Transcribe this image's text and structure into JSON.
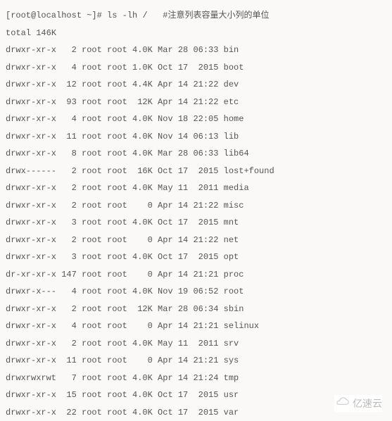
{
  "prompt": "[root@localhost ~]# ",
  "command": "ls -lh /",
  "spacer": "   ",
  "comment": "#注意列表容量大小列的单位",
  "total_label": "total ",
  "total_value": "146K",
  "rows": [
    {
      "perm": "drwxr-xr-x",
      "links": "2",
      "owner": "root",
      "group": "root",
      "size": "4.0K",
      "date": "Mar 28 06:33",
      "name": "bin"
    },
    {
      "perm": "drwxr-xr-x",
      "links": "4",
      "owner": "root",
      "group": "root",
      "size": "1.0K",
      "date": "Oct 17  2015",
      "name": "boot"
    },
    {
      "perm": "drwxr-xr-x",
      "links": "12",
      "owner": "root",
      "group": "root",
      "size": "4.4K",
      "date": "Apr 14 21:22",
      "name": "dev"
    },
    {
      "perm": "drwxr-xr-x",
      "links": "93",
      "owner": "root",
      "group": "root",
      "size": "12K",
      "date": "Apr 14 21:22",
      "name": "etc"
    },
    {
      "perm": "drwxr-xr-x",
      "links": "4",
      "owner": "root",
      "group": "root",
      "size": "4.0K",
      "date": "Nov 18 22:05",
      "name": "home"
    },
    {
      "perm": "drwxr-xr-x",
      "links": "11",
      "owner": "root",
      "group": "root",
      "size": "4.0K",
      "date": "Nov 14 06:13",
      "name": "lib"
    },
    {
      "perm": "drwxr-xr-x",
      "links": "8",
      "owner": "root",
      "group": "root",
      "size": "4.0K",
      "date": "Mar 28 06:33",
      "name": "lib64"
    },
    {
      "perm": "drwx------",
      "links": "2",
      "owner": "root",
      "group": "root",
      "size": "16K",
      "date": "Oct 17  2015",
      "name": "lost+found"
    },
    {
      "perm": "drwxr-xr-x",
      "links": "2",
      "owner": "root",
      "group": "root",
      "size": "4.0K",
      "date": "May 11  2011",
      "name": "media"
    },
    {
      "perm": "drwxr-xr-x",
      "links": "2",
      "owner": "root",
      "group": "root",
      "size": "0",
      "date": "Apr 14 21:22",
      "name": "misc"
    },
    {
      "perm": "drwxr-xr-x",
      "links": "3",
      "owner": "root",
      "group": "root",
      "size": "4.0K",
      "date": "Oct 17  2015",
      "name": "mnt"
    },
    {
      "perm": "drwxr-xr-x",
      "links": "2",
      "owner": "root",
      "group": "root",
      "size": "0",
      "date": "Apr 14 21:22",
      "name": "net"
    },
    {
      "perm": "drwxr-xr-x",
      "links": "3",
      "owner": "root",
      "group": "root",
      "size": "4.0K",
      "date": "Oct 17  2015",
      "name": "opt"
    },
    {
      "perm": "dr-xr-xr-x",
      "links": "147",
      "owner": "root",
      "group": "root",
      "size": "0",
      "date": "Apr 14 21:21",
      "name": "proc"
    },
    {
      "perm": "drwxr-x---",
      "links": "4",
      "owner": "root",
      "group": "root",
      "size": "4.0K",
      "date": "Nov 19 06:52",
      "name": "root"
    },
    {
      "perm": "drwxr-xr-x",
      "links": "2",
      "owner": "root",
      "group": "root",
      "size": "12K",
      "date": "Mar 28 06:34",
      "name": "sbin"
    },
    {
      "perm": "drwxr-xr-x",
      "links": "4",
      "owner": "root",
      "group": "root",
      "size": "0",
      "date": "Apr 14 21:21",
      "name": "selinux"
    },
    {
      "perm": "drwxr-xr-x",
      "links": "2",
      "owner": "root",
      "group": "root",
      "size": "4.0K",
      "date": "May 11  2011",
      "name": "srv"
    },
    {
      "perm": "drwxr-xr-x",
      "links": "11",
      "owner": "root",
      "group": "root",
      "size": "0",
      "date": "Apr 14 21:21",
      "name": "sys"
    },
    {
      "perm": "drwxrwxrwt",
      "links": "7",
      "owner": "root",
      "group": "root",
      "size": "4.0K",
      "date": "Apr 14 21:24",
      "name": "tmp"
    },
    {
      "perm": "drwxr-xr-x",
      "links": "15",
      "owner": "root",
      "group": "root",
      "size": "4.0K",
      "date": "Oct 17  2015",
      "name": "usr"
    },
    {
      "perm": "drwxr-xr-x",
      "links": "22",
      "owner": "root",
      "group": "root",
      "size": "4.0K",
      "date": "Oct 17  2015",
      "name": "var"
    }
  ],
  "watermark": "亿速云"
}
